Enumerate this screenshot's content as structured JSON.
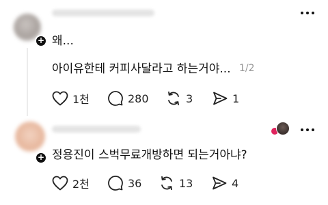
{
  "posts": [
    {
      "lines": [
        "왜...",
        "아이유한테 커피사달라고 하는거야..."
      ],
      "page_indicator": "1/2",
      "actions": {
        "likes": "1천",
        "comments": "280",
        "reposts": "3",
        "shares": "1"
      }
    },
    {
      "lines": [
        "정용진이 스벅무료개방하면 되는거아냐?"
      ],
      "actions": {
        "likes": "2천",
        "comments": "36",
        "reposts": "13",
        "shares": "4"
      }
    }
  ],
  "icons": {
    "like": "heart-icon",
    "comment": "comment-bubble-icon",
    "repost": "repost-icon",
    "share": "share-send-icon",
    "more": "more-options-icon",
    "follow": "plus-icon"
  },
  "colors": {
    "text": "#111111",
    "muted": "#999999",
    "reaction_heart": "#e0245e"
  }
}
